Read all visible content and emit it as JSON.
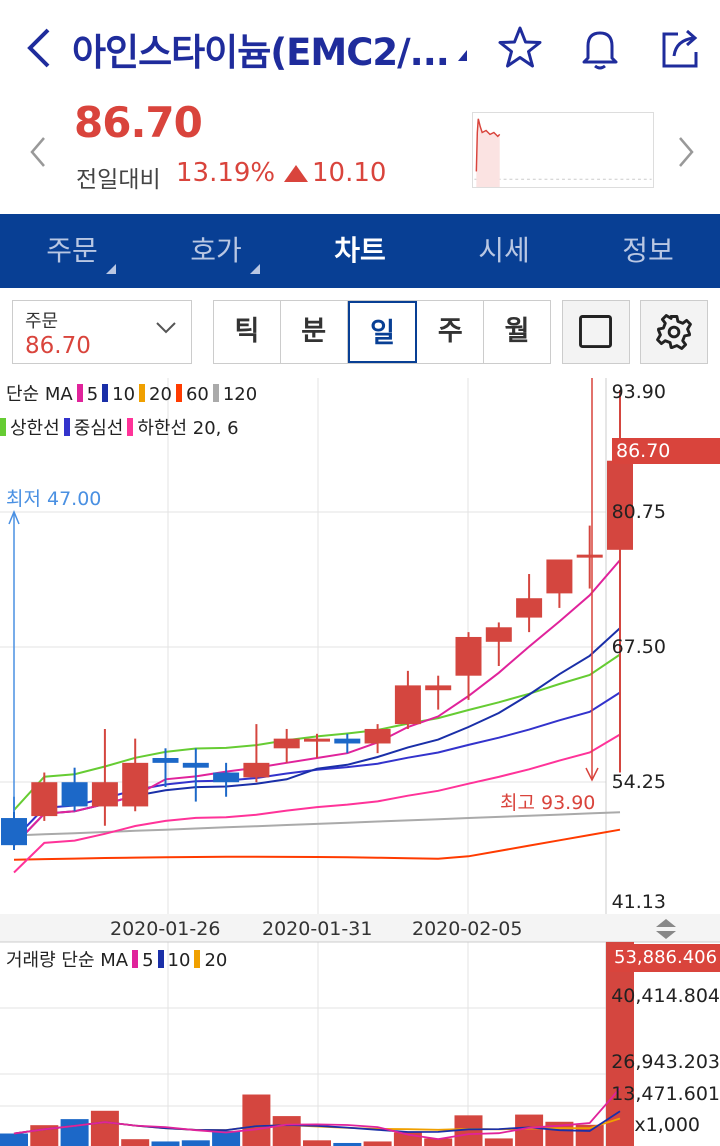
{
  "header": {
    "title": "아인스타이늄(EMC2/...",
    "icons": [
      "back-icon",
      "star-icon",
      "bell-icon",
      "share-icon"
    ]
  },
  "quote": {
    "price": "86.70",
    "prev_label": "전일대비",
    "change_pct": "13.19%",
    "change_abs": "10.10",
    "direction": "up",
    "up_color": "#d9443c"
  },
  "tabs": [
    {
      "label": "주문",
      "active": false
    },
    {
      "label": "호가",
      "active": false
    },
    {
      "label": "차트",
      "active": true
    },
    {
      "label": "시세",
      "active": false
    },
    {
      "label": "정보",
      "active": false
    }
  ],
  "order": {
    "label": "주문",
    "value": "86.70"
  },
  "periods": [
    {
      "label": "틱",
      "active": false
    },
    {
      "label": "분",
      "active": false
    },
    {
      "label": "일",
      "active": true
    },
    {
      "label": "주",
      "active": false
    },
    {
      "label": "월",
      "active": false
    }
  ],
  "legend": {
    "ma_title": "단순 MA",
    "ma": [
      {
        "label": "5",
        "color": "#e0239b"
      },
      {
        "label": "10",
        "color": "#1a2fa8"
      },
      {
        "label": "20",
        "color": "#f0a000"
      },
      {
        "label": "60",
        "color": "#ff3b00"
      },
      {
        "label": "120",
        "color": "#aaaaaa"
      }
    ],
    "env": [
      {
        "label": "상한선",
        "color": "#66cc33"
      },
      {
        "label": "중심선",
        "color": "#3333cc"
      },
      {
        "label": "하한선 20, 6",
        "color": "#ff3399"
      }
    ]
  },
  "annotations": {
    "low": "최저 47.00",
    "high": "최고 93.90",
    "last_price": "86.70"
  },
  "price_axis": [
    "93.90",
    "80.75",
    "67.50",
    "54.25",
    "41.13"
  ],
  "date_axis": [
    "2020-01-26",
    "2020-01-31",
    "2020-02-05"
  ],
  "volume": {
    "legend_title": "거래량 단순 MA",
    "ma": [
      {
        "label": "5",
        "color": "#e0239b"
      },
      {
        "label": "10",
        "color": "#1a2fa8"
      },
      {
        "label": "20",
        "color": "#f0a000"
      }
    ],
    "axis": [
      "53,886.406",
      "40,414.804",
      "26,943.203",
      "13,471.601",
      "x1,000"
    ],
    "unit": "x1,000"
  },
  "chart_data": {
    "type": "candlestick",
    "ylim": [
      41.13,
      93.9
    ],
    "candles": [
      {
        "o": 49.8,
        "h": 52.0,
        "l": 46.5,
        "c": 47.0
      },
      {
        "o": 50.0,
        "h": 54.5,
        "l": 49.5,
        "c": 53.5
      },
      {
        "o": 53.5,
        "h": 55.0,
        "l": 50.5,
        "c": 51.0
      },
      {
        "o": 51.0,
        "h": 59.0,
        "l": 49.0,
        "c": 53.5
      },
      {
        "o": 51.0,
        "h": 58.0,
        "l": 50.5,
        "c": 55.5
      },
      {
        "o": 56.0,
        "h": 57.0,
        "l": 53.0,
        "c": 55.5
      },
      {
        "o": 55.5,
        "h": 57.0,
        "l": 51.5,
        "c": 55.0
      },
      {
        "o": 54.5,
        "h": 55.5,
        "l": 52.0,
        "c": 53.5
      },
      {
        "o": 54.0,
        "h": 59.5,
        "l": 53.5,
        "c": 55.5
      },
      {
        "o": 57.0,
        "h": 59.0,
        "l": 55.5,
        "c": 58.0
      },
      {
        "o": 58.0,
        "h": 58.5,
        "l": 56.0,
        "c": 58.0
      },
      {
        "o": 58.0,
        "h": 58.5,
        "l": 56.5,
        "c": 57.5
      },
      {
        "o": 57.5,
        "h": 59.5,
        "l": 56.5,
        "c": 59.0
      },
      {
        "o": 59.5,
        "h": 65.0,
        "l": 59.0,
        "c": 63.5
      },
      {
        "o": 63.0,
        "h": 64.5,
        "l": 61.0,
        "c": 63.5
      },
      {
        "o": 64.5,
        "h": 69.0,
        "l": 62.0,
        "c": 68.5
      },
      {
        "o": 68.0,
        "h": 70.0,
        "l": 65.5,
        "c": 69.5
      },
      {
        "o": 70.5,
        "h": 75.0,
        "l": 69.0,
        "c": 72.5
      },
      {
        "o": 73.0,
        "h": 76.0,
        "l": 71.5,
        "c": 76.5
      },
      {
        "o": 77.0,
        "h": 80.0,
        "l": 73.5,
        "c": 77.0
      },
      {
        "o": 77.5,
        "h": 94.0,
        "l": 54.5,
        "c": 86.7
      }
    ],
    "volume": [
      3.3,
      5.5,
      7.1,
      9.3,
      1.8,
      1.2,
      1.5,
      4.0,
      13.6,
      7.9,
      1.5,
      0.8,
      1.2,
      3.6,
      2.0,
      8.1,
      2.0,
      8.3,
      6.4,
      5.6,
      53.9
    ]
  }
}
